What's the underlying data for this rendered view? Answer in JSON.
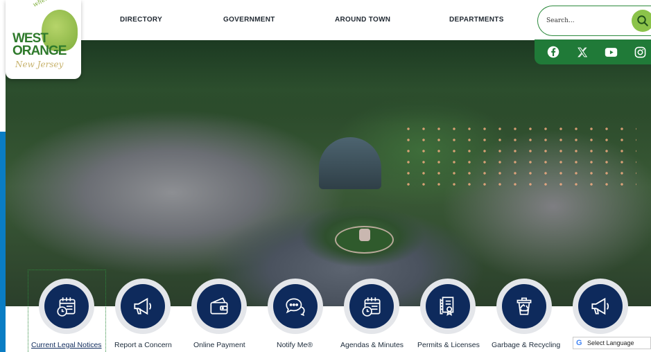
{
  "logo": {
    "tagline": "where invention lives",
    "line1": "WEST",
    "line2": "ORANGE",
    "line3": "New Jersey"
  },
  "nav": {
    "items": [
      "DIRECTORY",
      "GOVERNMENT",
      "AROUND TOWN",
      "DEPARTMENTS"
    ]
  },
  "search": {
    "placeholder": "Search..."
  },
  "social": {
    "icons": [
      "facebook-icon",
      "x-icon",
      "youtube-icon",
      "instagram-icon"
    ]
  },
  "quick_links": [
    {
      "label": "Current Legal Notices",
      "icon": "calendar-clock-icon"
    },
    {
      "label": "Report a Concern",
      "icon": "megaphone-icon"
    },
    {
      "label": "Online Payment",
      "icon": "wallet-icon"
    },
    {
      "label": "Notify Me®",
      "icon": "chat-bubbles-icon"
    },
    {
      "label": "Agendas & Minutes",
      "icon": "calendar-clock-icon"
    },
    {
      "label": "Permits & Licenses",
      "icon": "certificate-icon"
    },
    {
      "label": "Garbage & Recycling",
      "icon": "recycling-bin-icon"
    },
    {
      "label": "",
      "icon": "megaphone-icon"
    }
  ],
  "translate": {
    "label": "Select Language"
  },
  "colors": {
    "nav_text": "#222a33",
    "green": "#207a38",
    "search_button": "#8bc34a",
    "icon_circle": "#0e2a5c",
    "accent_blue": "#0a7dc4"
  }
}
